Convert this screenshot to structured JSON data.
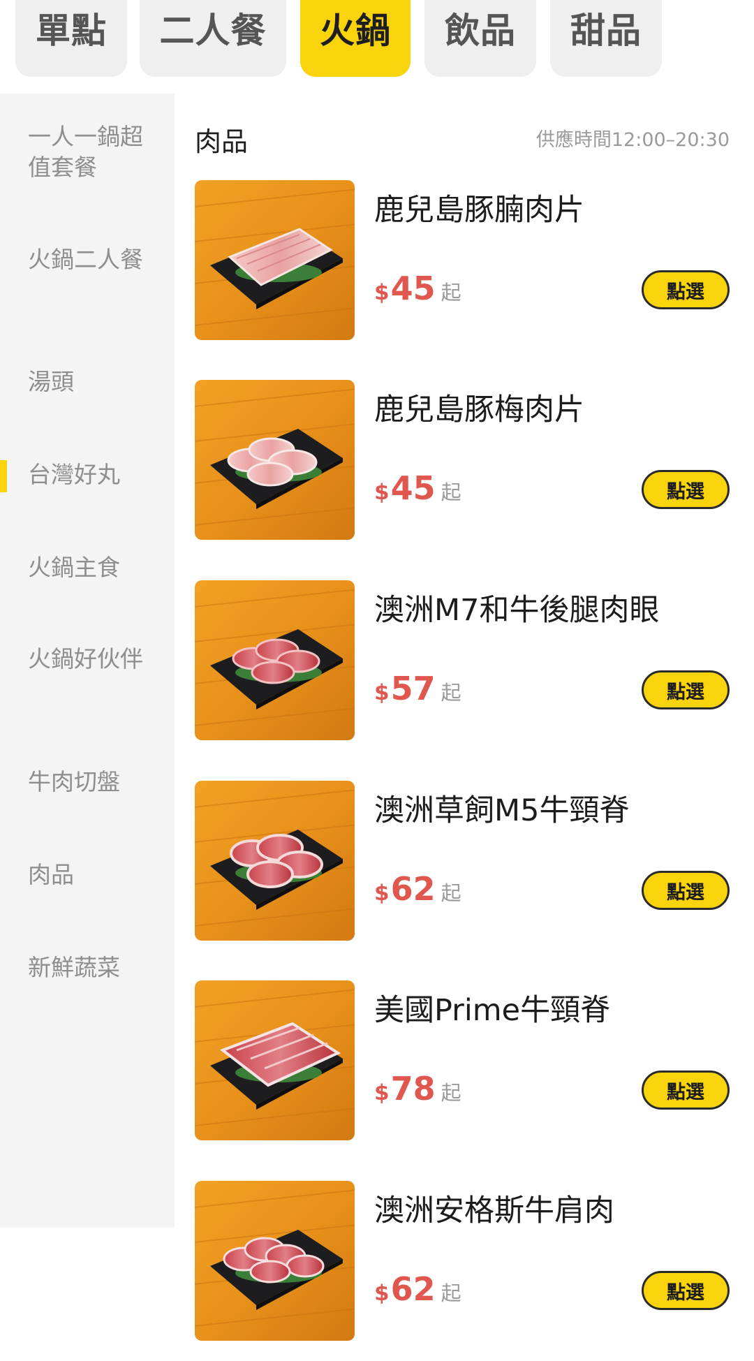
{
  "top_tabs": [
    {
      "label": "單點",
      "active": false
    },
    {
      "label": "二人餐",
      "active": false
    },
    {
      "label": "火鍋",
      "active": true
    },
    {
      "label": "飲品",
      "active": false
    },
    {
      "label": "甜品",
      "active": false
    }
  ],
  "sidebar": {
    "items": [
      {
        "label": "一人一鍋超值套餐"
      },
      {
        "label": "火鍋二人餐"
      },
      {
        "label": "湯頭"
      },
      {
        "label": "台灣好丸",
        "active": true
      },
      {
        "label": "火鍋主食"
      },
      {
        "label": "火鍋好伙伴"
      },
      {
        "label": "牛肉切盤"
      },
      {
        "label": "肉品"
      },
      {
        "label": "新鮮蔬菜"
      }
    ]
  },
  "section": {
    "title": "肉品",
    "service_hours": "供應時間12:00–20:30"
  },
  "products": [
    {
      "name": "鹿兒島豚腩肉片",
      "currency": "$",
      "price": "45",
      "suffix": "起",
      "button": "點選",
      "image_icon": "meat-slices-icon"
    },
    {
      "name": "鹿兒島豚梅肉片",
      "currency": "$",
      "price": "45",
      "suffix": "起",
      "button": "點選",
      "image_icon": "meat-slices-icon"
    },
    {
      "name": "澳洲M7和牛後腿肉眼",
      "currency": "$",
      "price": "57",
      "suffix": "起",
      "button": "點選",
      "image_icon": "meat-slices-icon"
    },
    {
      "name": "澳洲草飼M5牛頸脊",
      "currency": "$",
      "price": "62",
      "suffix": "起",
      "button": "點選",
      "image_icon": "meat-slices-icon"
    },
    {
      "name": "美國Prime牛頸脊",
      "currency": "$",
      "price": "78",
      "suffix": "起",
      "button": "點選",
      "image_icon": "meat-slices-icon"
    },
    {
      "name": "澳洲安格斯牛肩肉",
      "currency": "$",
      "price": "62",
      "suffix": "起",
      "button": "點選",
      "image_icon": "meat-slices-icon"
    }
  ],
  "colors": {
    "accent": "#f9d30b",
    "price": "#e0574f",
    "sidebar_bg": "#f4f4f4",
    "tab_bg": "#efefef"
  }
}
